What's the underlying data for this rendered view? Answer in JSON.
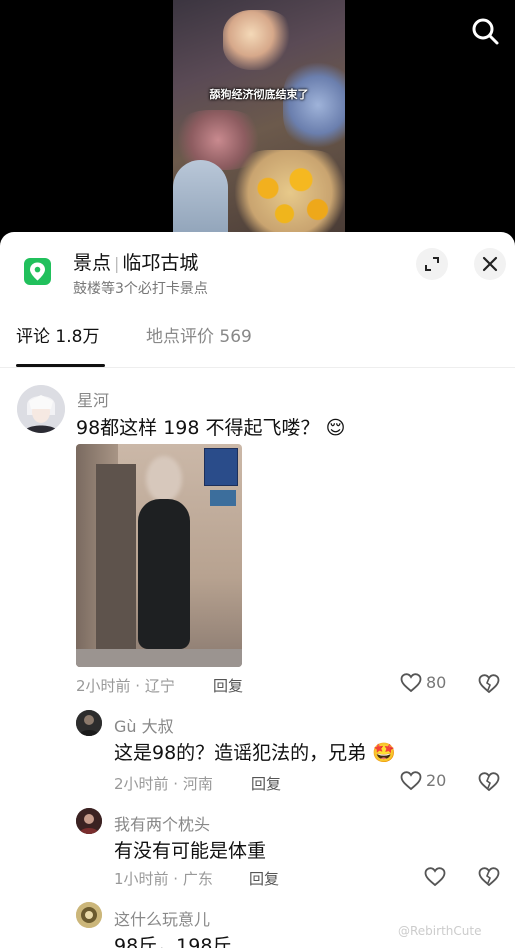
{
  "video": {
    "caption": "舔狗经济彻底结束了"
  },
  "place": {
    "category": "景点",
    "name": "临邛古城",
    "subtitle": "鼓楼等3个必打卡景点"
  },
  "tabs": [
    {
      "label": "评论 1.8万"
    },
    {
      "label": "地点评价 569"
    }
  ],
  "comments": [
    {
      "author": "星河",
      "text": "98都这样 198 不得起飞喽？",
      "emoji": "😌",
      "time_location": "2小时前 · 辽宁",
      "reply_label": "回复",
      "likes": "80"
    }
  ],
  "replies": [
    {
      "author": "Gù 大叔",
      "text": "这是98的？造谣犯法的，兄弟",
      "emoji": "🤩",
      "time_location": "2小时前 · 河南",
      "reply_label": "回复",
      "likes": "20"
    },
    {
      "author": "我有两个枕头",
      "text": "有没有可能是体重",
      "time_location": "1小时前 · 广东",
      "reply_label": "回复",
      "likes": ""
    },
    {
      "author": "这什么玩意儿",
      "text": "98斤，198斤"
    }
  ],
  "watermark": "@RebirthCute",
  "colors": {
    "accent_green": "#21c05c",
    "text_primary": "#111111",
    "text_secondary": "#888888"
  }
}
